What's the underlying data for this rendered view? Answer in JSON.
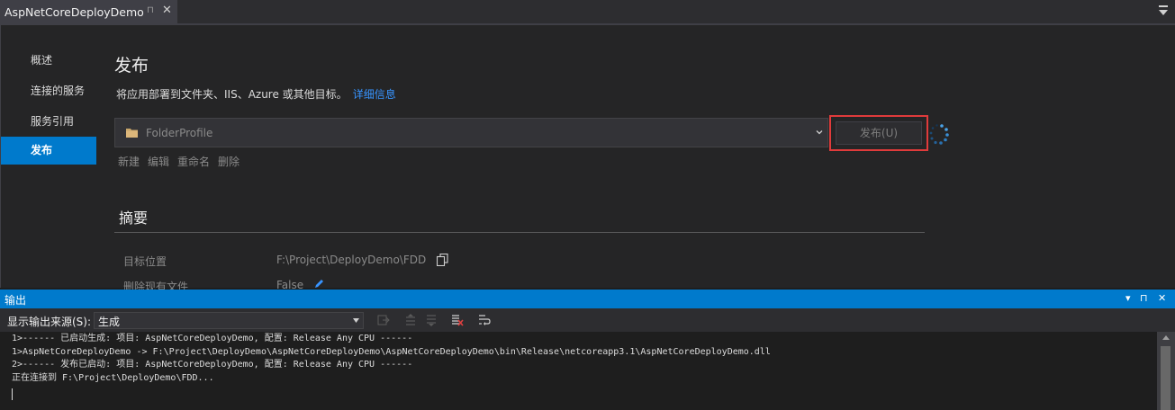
{
  "document_tab": {
    "title": "AspNetCoreDeployDemo",
    "pin": "⊓",
    "close": "✕"
  },
  "nav": {
    "items": [
      {
        "label": "概述"
      },
      {
        "label": "连接的服务"
      },
      {
        "label": "服务引用"
      },
      {
        "label": "发布",
        "active": true
      }
    ]
  },
  "publish": {
    "title": "发布",
    "description": "将应用部署到文件夹、IIS、Azure 或其他目标。",
    "more_info_link": "详细信息",
    "profile_name": "FolderProfile",
    "publish_button": "发布(U)",
    "actions": [
      "新建",
      "编辑",
      "重命名",
      "删除"
    ]
  },
  "summary": {
    "title": "摘要",
    "rows": [
      {
        "label": "目标位置",
        "value": "F:\\Project\\DeployDemo\\FDD"
      },
      {
        "label": "删除现有文件",
        "value": "False"
      }
    ]
  },
  "output": {
    "title": "输出",
    "source_label": "显示输出来源(S):",
    "source_value": "生成",
    "lines": [
      "1>------ 已启动生成: 项目: AspNetCoreDeployDemo, 配置: Release Any CPU ------",
      "1>AspNetCoreDeployDemo -> F:\\Project\\DeployDemo\\AspNetCoreDeployDemo\\AspNetCoreDeployDemo\\bin\\Release\\netcoreapp3.1\\AspNetCoreDeployDemo.dll",
      "2>------ 发布已启动: 项目: AspNetCoreDeployDemo, 配置: Release Any CPU ------",
      "正在连接到 F:\\Project\\DeployDemo\\FDD..."
    ],
    "window_controls": [
      "▾",
      "⊓",
      "✕"
    ]
  },
  "colors": {
    "accent": "#007acc",
    "highlight_border": "#e03b3b",
    "link": "#3794ff"
  }
}
